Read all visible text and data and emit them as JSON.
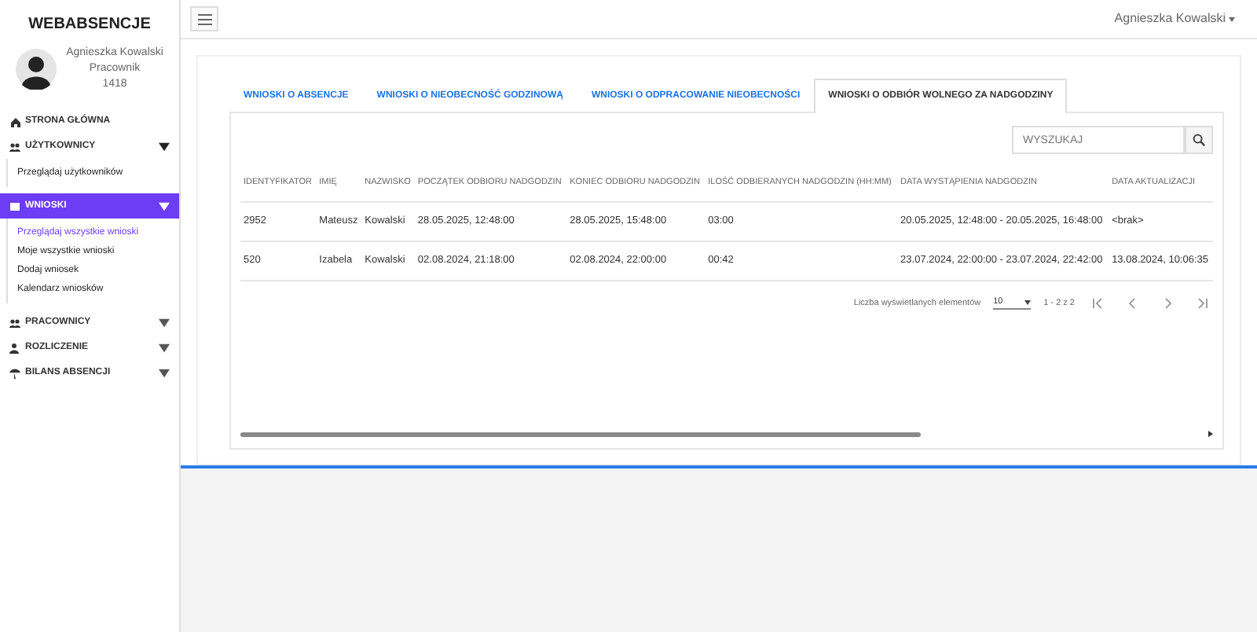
{
  "sidebar": {
    "brand": "WEBABSENCJE",
    "user": {
      "name": "Agnieszka Kowalski",
      "role": "Pracownik",
      "number": "1418"
    },
    "menu": [
      {
        "label": "STRONA GŁÓWNA",
        "selected": false
      },
      {
        "label": "UŻYTKOWNICY",
        "expanded": true,
        "selected": false,
        "children": [
          {
            "label": "Przeglądaj użytkowników",
            "selected": false
          }
        ]
      },
      {
        "label": "WNIOSKI",
        "expanded": true,
        "selected": true,
        "children": [
          {
            "label": "Przeglądaj wszystkie wnioski",
            "selected": true
          },
          {
            "label": "Moje wszystkie wnioski",
            "selected": false
          },
          {
            "label": "Dodaj wniosek",
            "selected": false
          },
          {
            "label": "Kalendarz wniosków",
            "selected": false
          }
        ]
      },
      {
        "label": "PRACOWNICY",
        "expanded": false,
        "selected": false
      },
      {
        "label": "ROZLICZENIE",
        "expanded": false,
        "selected": false
      },
      {
        "label": "BILANS ABSENCJI",
        "expanded": false,
        "selected": false
      }
    ]
  },
  "topbar": {
    "user": "Agnieszka Kowalski"
  },
  "tabs": [
    {
      "label": "WNIOSKI O ABSENCJE",
      "selected": false
    },
    {
      "label": "WNIOSKI O NIEOBECNOŚĆ GODZINOWĄ",
      "selected": false
    },
    {
      "label": "WNIOSKI O ODPRACOWANIE NIEOBECNOŚCI",
      "selected": false
    },
    {
      "label": "WNIOSKI O ODBIÓR WOLNEGO ZA NADGODZINY",
      "selected": true
    }
  ],
  "search": {
    "placeholder": "WYSZUKAJ"
  },
  "table": {
    "columns": [
      "IDENTYFIKATOR",
      "IMIĘ",
      "NAZWISKO",
      "POCZĄTEK ODBIORU NADGODZIN",
      "KONIEC ODBIORU NADGODZIN",
      "ILOŚĆ ODBIERANYCH NADGODZIN (HH:MM)",
      "DATA WYSTĄPIENIA NADGODZIN",
      "DATA AKTUALIZACJI"
    ],
    "rows": [
      [
        "2952",
        "Mateusz",
        "Kowalski",
        "28.05.2025, 12:48:00",
        "28.05.2025, 15:48:00",
        "03:00",
        "20.05.2025, 12:48:00 - 20.05.2025, 16:48:00",
        "<brak>"
      ],
      [
        "520",
        "Izabela",
        "Kowalski",
        "02.08.2024, 21:18:00",
        "02.08.2024, 22:00:00",
        "00:42",
        "23.07.2024, 22:00:00 - 23.07.2024, 22:42:00",
        "13.08.2024, 10:06:35"
      ]
    ]
  },
  "paginator": {
    "label": "Liczba wyświetlanych elementów",
    "page_size": "10",
    "range": "1 - 2 z 2"
  }
}
